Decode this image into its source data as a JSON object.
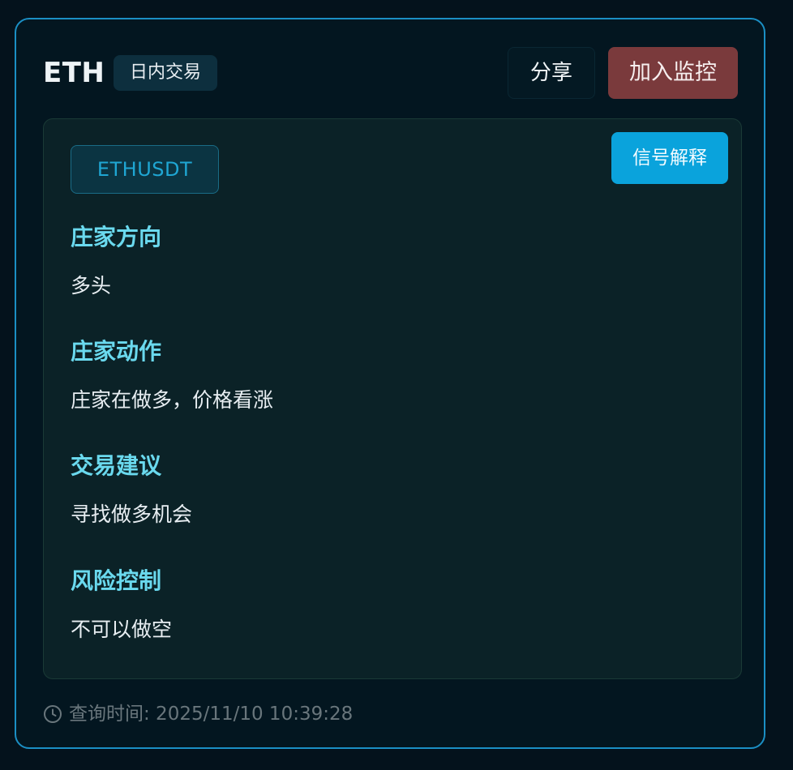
{
  "header": {
    "symbol": "ETH",
    "mode_tag": "日内交易",
    "share_label": "分享",
    "monitor_label": "加入监控"
  },
  "panel": {
    "pair": "ETHUSDT",
    "explain_label": "信号解释",
    "sections": [
      {
        "title": "庄家方向",
        "body": "多头"
      },
      {
        "title": "庄家动作",
        "body": "庄家在做多，价格看涨"
      },
      {
        "title": "交易建议",
        "body": "寻找做多机会"
      },
      {
        "title": "风险控制",
        "body": "不可以做空"
      }
    ]
  },
  "footer": {
    "icon": "clock-icon",
    "query_time": "查询时间: 2025/11/10 10:39:28"
  },
  "colors": {
    "background": "#04121c",
    "border_accent": "#1b8fc4",
    "section_title": "#6ad9ee",
    "monitor_button": "#7a3a3c",
    "explain_button": "#0aa3dc",
    "pair_text": "#1fa6d3"
  }
}
